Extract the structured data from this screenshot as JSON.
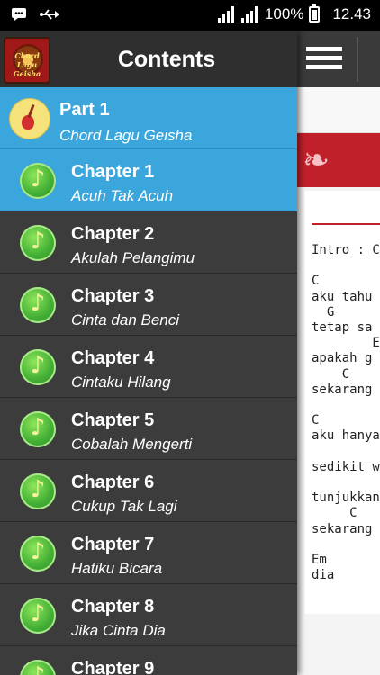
{
  "status_bar": {
    "battery_percent": "100%",
    "time": "12.43",
    "icons": [
      "bbm-icon",
      "usb-icon",
      "wifi-signal-icon",
      "cell-signal-icon",
      "battery-icon"
    ]
  },
  "drawer": {
    "title": "Contents",
    "logo_text": "Chord Lagu Geisha",
    "part": {
      "label": "Part 1",
      "subtitle": "Chord Lagu Geisha"
    },
    "chapters": [
      {
        "label": "Chapter 1",
        "subtitle": "Acuh Tak Acuh",
        "active": true
      },
      {
        "label": "Chapter 2",
        "subtitle": "Akulah Pelangimu"
      },
      {
        "label": "Chapter 3",
        "subtitle": "Cinta dan Benci"
      },
      {
        "label": "Chapter 4",
        "subtitle": "Cintaku Hilang"
      },
      {
        "label": "Chapter 5",
        "subtitle": "Cobalah Mengerti"
      },
      {
        "label": "Chapter 6",
        "subtitle": "Cukup Tak Lagi"
      },
      {
        "label": "Chapter 7",
        "subtitle": "Hatiku Bicara"
      },
      {
        "label": "Chapter 8",
        "subtitle": "Jika Cinta Dia"
      },
      {
        "label": "Chapter 9",
        "subtitle": ""
      }
    ]
  },
  "content": {
    "lyrics_lines": [
      "Intro : C",
      "",
      "C",
      "aku tahu",
      "  G",
      "tetap sa",
      "        E",
      "apakah g",
      "    C",
      "sekarang",
      "",
      "C",
      "aku hanya",
      "",
      "sedikit w",
      "",
      "tunjukkan",
      "     C",
      "sekarang",
      "",
      "Em",
      "dia"
    ]
  },
  "colors": {
    "accent": "#3aa6dc",
    "drawer_bg": "#3c3c3c",
    "banner_red": "#c0202a"
  }
}
